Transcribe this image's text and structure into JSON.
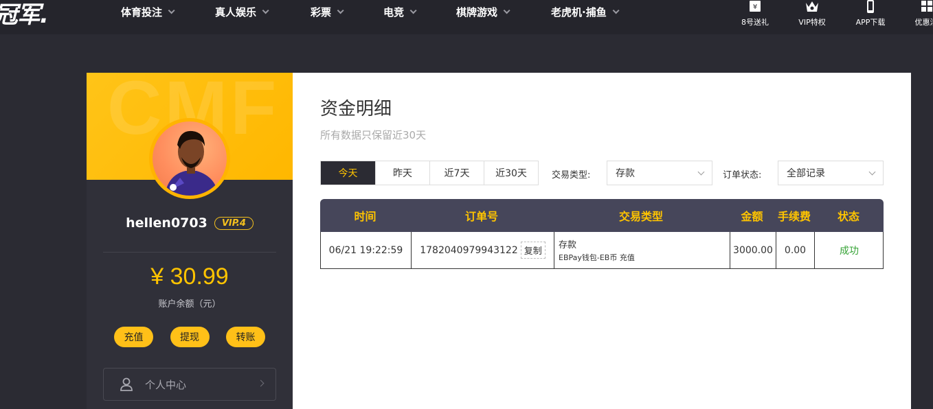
{
  "brand": {
    "logo_text": "冠军."
  },
  "nav": {
    "items": [
      {
        "label": "体育投注"
      },
      {
        "label": "真人娱乐"
      },
      {
        "label": "彩票"
      },
      {
        "label": "电竞"
      },
      {
        "label": "棋牌游戏"
      },
      {
        "label": "老虎机·捕鱼"
      }
    ],
    "tools": [
      {
        "label": "8号送礼",
        "icon": "gift-icon"
      },
      {
        "label": "VIP特权",
        "icon": "crown-icon"
      },
      {
        "label": "APP下载",
        "icon": "phone-icon"
      },
      {
        "label": "优惠活",
        "icon": "promo-icon"
      }
    ]
  },
  "profile": {
    "banner_watermark": "CMF",
    "username": "hellen0703",
    "vip": "VIP.4",
    "balance": "¥ 30.99",
    "balance_label": "账户余额（元）",
    "actions": {
      "deposit": "充值",
      "withdraw": "提现",
      "transfer": "转账"
    },
    "menu": {
      "personal_center": "个人中心"
    }
  },
  "main": {
    "title": "资金明细",
    "subtitle": "所有数据只保留近30天",
    "date_tabs": [
      {
        "label": "今天",
        "active": true
      },
      {
        "label": "昨天",
        "active": false
      },
      {
        "label": "近7天",
        "active": false
      },
      {
        "label": "近30天",
        "active": false
      }
    ],
    "filters": {
      "type_label": "交易类型:",
      "type_value": "存款",
      "status_label": "订单状态:",
      "status_value": "全部记录"
    },
    "table": {
      "headers": {
        "time": "时间",
        "order": "订单号",
        "type": "交易类型",
        "amount": "金额",
        "fee": "手续费",
        "status": "状态"
      },
      "rows": [
        {
          "time": "06/21 19:22:59",
          "order": "1782040979943122",
          "copy": "复制",
          "type": "存款",
          "type_detail": "EBPay钱包-EB币 充值",
          "amount": "3000.00",
          "fee": "0.00",
          "status": "成功"
        }
      ]
    }
  },
  "colors": {
    "accent": "#ffc400",
    "dark": "#2b2b33",
    "success": "#35a335"
  }
}
